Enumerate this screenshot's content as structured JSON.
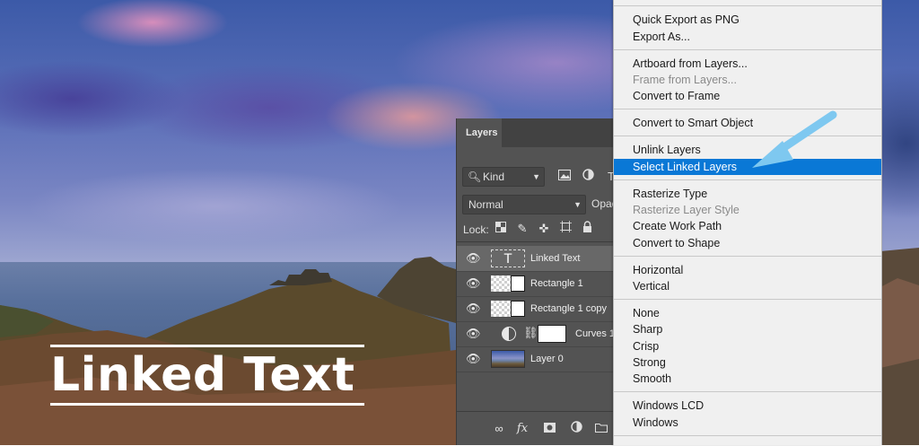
{
  "title_overlay": {
    "text": "Linked Text"
  },
  "layers_panel": {
    "tab_label": "Layers",
    "filter_label": "Kind",
    "blend_mode": "Normal",
    "opacity_label": "Opac",
    "lock_label": "Lock:",
    "layers": [
      {
        "name": "Linked Text",
        "type": "text",
        "thumb_glyph": "T",
        "selected": true
      },
      {
        "name": "Rectangle 1",
        "type": "shape"
      },
      {
        "name": "Rectangle 1 copy",
        "type": "shape"
      },
      {
        "name": "Curves 1",
        "type": "adjustment"
      },
      {
        "name": "Layer 0",
        "type": "photo"
      }
    ],
    "bottom_icons": [
      "link-icon",
      "fx-icon",
      "mask-icon",
      "adjustment-icon",
      "folder-icon"
    ]
  },
  "context_menu": {
    "groups": [
      [
        {
          "label": "Quick Export as PNG"
        },
        {
          "label": "Export As..."
        }
      ],
      [
        {
          "label": "Artboard from Layers..."
        },
        {
          "label": "Frame from Layers...",
          "disabled": true
        },
        {
          "label": "Convert to Frame"
        }
      ],
      [
        {
          "label": "Convert to Smart Object"
        }
      ],
      [
        {
          "label": "Unlink Layers"
        },
        {
          "label": "Select Linked Layers",
          "highlighted": true
        }
      ],
      [
        {
          "label": "Rasterize Type"
        },
        {
          "label": "Rasterize Layer Style",
          "disabled": true
        },
        {
          "label": "Create Work Path"
        },
        {
          "label": "Convert to Shape"
        }
      ],
      [
        {
          "label": "Horizontal"
        },
        {
          "label": "Vertical"
        }
      ],
      [
        {
          "label": "None"
        },
        {
          "label": "Sharp"
        },
        {
          "label": "Crisp"
        },
        {
          "label": "Strong"
        },
        {
          "label": "Smooth"
        }
      ],
      [
        {
          "label": "Windows LCD"
        },
        {
          "label": "Windows"
        }
      ]
    ]
  },
  "colors": {
    "menu_highlight": "#0a78d6",
    "arrow": "#7ec8f0",
    "panel_bg": "#535353"
  }
}
